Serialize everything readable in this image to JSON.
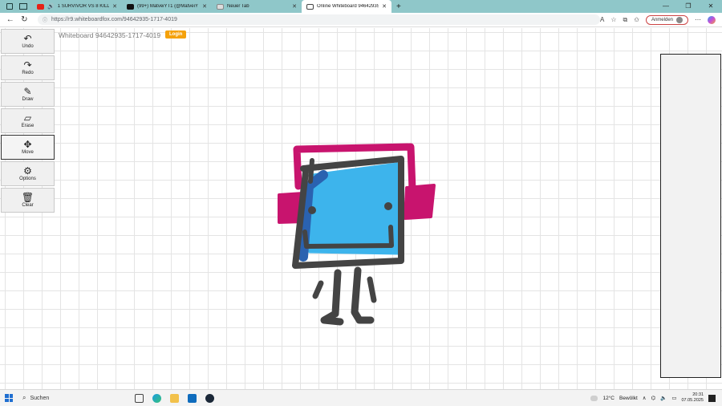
{
  "browser": {
    "tabs": [
      {
        "label": "1 SURVIVOR VS 8 KILLERS!!",
        "favicon": "youtube-icon",
        "audio": true
      },
      {
        "label": "(99+) MatveiYT1 (@MatveiYT1) ·",
        "favicon": "x-icon"
      },
      {
        "label": "Neuer Tab",
        "favicon": "edge-icon"
      },
      {
        "label": "Online Whiteboard 94642935-17",
        "favicon": "whiteboard-icon",
        "active": true
      }
    ],
    "new_tab_symbol": "+",
    "url_host": "https://r9.whiteboardfox.com",
    "url_path": "/94642935-1717-4019",
    "signin_label": "Anmelden",
    "window_controls": [
      "—",
      "❐",
      "✕"
    ]
  },
  "whiteboard": {
    "title": "Whiteboard 94642935-1717-4019",
    "login_label": "Login",
    "tools": [
      {
        "label": "Undo",
        "icon": "undo-icon",
        "glyph": "↶"
      },
      {
        "label": "Redo",
        "icon": "redo-icon",
        "glyph": "↷"
      },
      {
        "label": "Draw",
        "icon": "pen-icon",
        "glyph": "✎"
      },
      {
        "label": "Erase",
        "icon": "eraser-icon",
        "glyph": "▱"
      },
      {
        "label": "Move",
        "icon": "move-icon",
        "glyph": "✥",
        "selected": true
      },
      {
        "label": "Options",
        "icon": "gear-icon",
        "glyph": "⚙"
      },
      {
        "label": "Clear",
        "icon": "trash-icon",
        "glyph": "🗑"
      }
    ],
    "colors": {
      "pink": "#c8146e",
      "blue": "#3db4ec",
      "dark_blue": "#2a62b0",
      "gray": "#444444"
    }
  },
  "taskbar": {
    "search_label": "Suchen",
    "weather": "12°C",
    "weather_desc": "Bewölkt",
    "time": "20:31",
    "date": "07.05.2025"
  }
}
